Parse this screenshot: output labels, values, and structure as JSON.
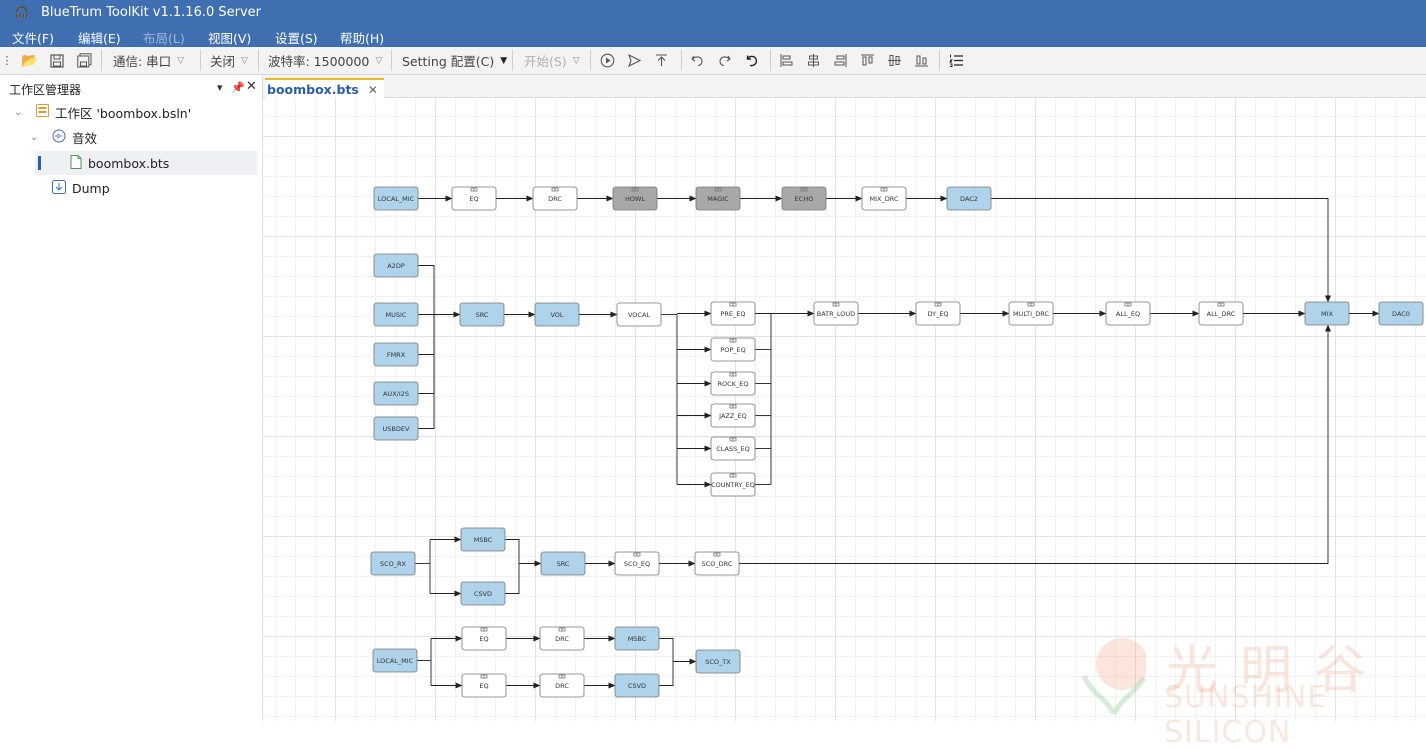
{
  "window": {
    "title": "BlueTrum ToolKit v1.1.16.0 Server"
  },
  "menu": [
    "文件(F)",
    "编辑(E)",
    "布局(L)",
    "视图(V)",
    "设置(S)",
    "帮助(H)"
  ],
  "toolbar": {
    "comm": "通信: 串口",
    "close": "关闭",
    "baud": "波特率: 1500000",
    "setting": "Setting 配置(C)",
    "start": "开始(S)"
  },
  "sidebar": {
    "title": "工作区管理器",
    "workspace": "工作区 'boombox.bsln'",
    "group": "音效",
    "file": "boombox.bts",
    "dump": "Dump"
  },
  "tab": {
    "label": "boombox.bts"
  },
  "nodes": {
    "r1": [
      "LOCAL_MIC",
      "EQ",
      "DRC",
      "HOWL",
      "MAGIC",
      "ECHO",
      "MIX_DRC",
      "DAC2"
    ],
    "src": [
      "A2DP",
      "MUSIC",
      "FMRX",
      "AUX/I2S",
      "USBDEV"
    ],
    "main": [
      "SRC",
      "VOL",
      "VOCAL"
    ],
    "eqs": [
      "PRE_EQ",
      "POP_EQ",
      "ROCK_EQ",
      "JAZZ_EQ",
      "CLASS_EQ",
      "COUNTRY_EQ"
    ],
    "post": [
      "BATR_LOUD",
      "DY_EQ",
      "MULTI_DRC",
      "ALL_EQ",
      "ALL_DRC",
      "MIX",
      "DAC0"
    ],
    "sco": [
      "SCO_RX",
      "MSBC",
      "CSVD",
      "SRC",
      "SCO_EQ",
      "SCO_DRC"
    ],
    "mic2": [
      "LOCAL_MIC",
      "EQ",
      "DRC",
      "MSBC",
      "EQ",
      "DRC",
      "CSVD",
      "SCO_TX"
    ]
  },
  "watermark": {
    "cn": "光明谷",
    "en": "SUNSHINE SILICON"
  },
  "colors": {
    "titlebar": "#3f6fb0",
    "node_blue": "#aed3ea",
    "node_gray": "#a8a8a8"
  }
}
